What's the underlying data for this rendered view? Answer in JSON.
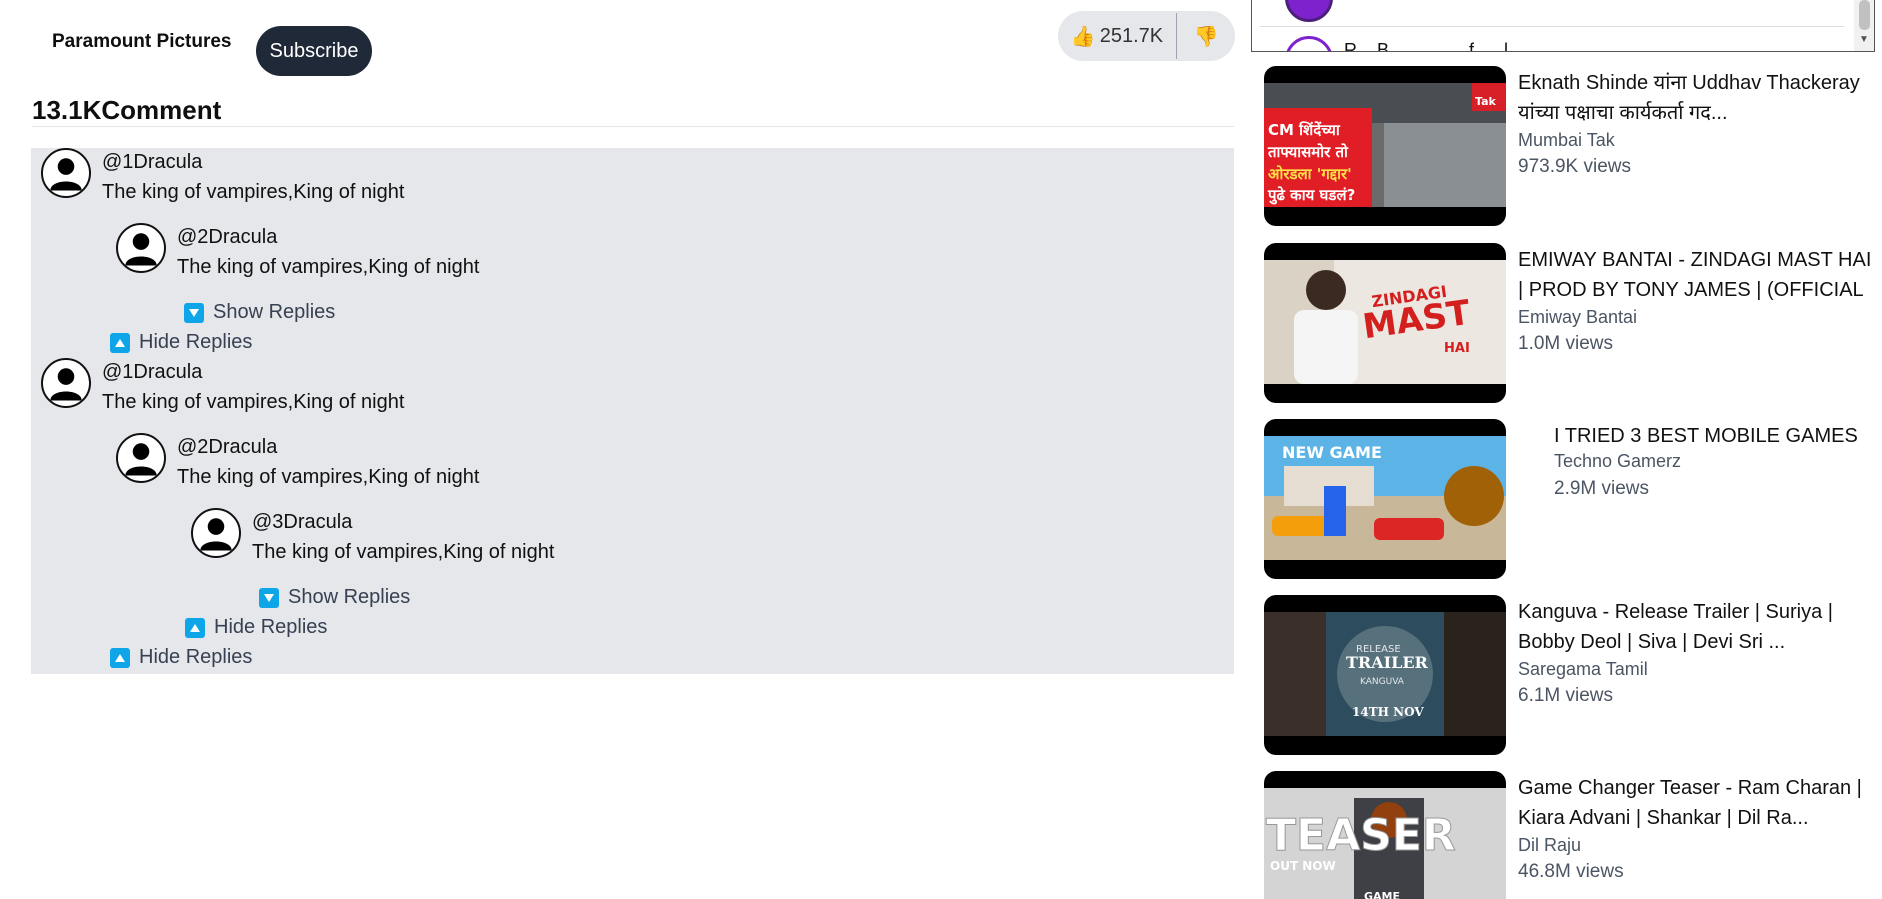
{
  "channel": {
    "name": "Paramount Pictures",
    "subscribe_label": "Subscribe"
  },
  "reactions": {
    "like_icon": "👍",
    "like_count": "251.7K",
    "dislike_icon": "👎"
  },
  "comments": {
    "count": "13.1K",
    "label": "Comment",
    "show_replies": "Show Replies",
    "hide_replies": "Hide Replies",
    "threads": [
      {
        "user": "@1Dracula",
        "text": "The king of vampires,King of night",
        "replies": [
          {
            "user": "@2Dracula",
            "text": "The king of vampires,King of night"
          }
        ]
      },
      {
        "user": "@1Dracula",
        "text": "The king of vampires,King of night",
        "replies": [
          {
            "user": "@2Dracula",
            "text": "The king of vampires,King of night",
            "replies": [
              {
                "user": "@3Dracula",
                "text": "The king of vampires,King of night"
              }
            ]
          }
        ]
      }
    ]
  },
  "popup": {
    "peek_text": "R... B... ... ... ... f. ... l ..."
  },
  "recommendations": [
    {
      "title": "Eknath Shinde यांना Uddhav Thackeray यांच्या पक्षाचा कार्यकर्ता गद...",
      "channel": "Mumbai Tak",
      "views": "973.9K views",
      "thumb_text": "CM शिंदेंच्या ताफ्यासमोर तो ओरडला 'गद्दार' पुढे काय घडलं?",
      "thumb_badge": "मुंबई Tak"
    },
    {
      "title": "EMIWAY BANTAI - ZINDAGI MAST HAI | PROD BY TONY JAMES | (OFFICIAL ...",
      "channel": "Emiway Bantai",
      "views": "1.0M views",
      "thumb_text": "ZINDAGI MAST HAI"
    },
    {
      "title": "I TRIED 3 BEST MOBILE GAMES",
      "channel": "Techno Gamerz",
      "views": "2.9M views",
      "thumb_text": "NEW GAME"
    },
    {
      "title": "Kanguva - Release Trailer | Suriya | Bobby Deol | Siva | Devi Sri ...",
      "channel": "Saregama Tamil",
      "views": "6.1M views",
      "thumb_text": "RELEASE TRAILER KANGUVA 14TH NOV"
    },
    {
      "title": "Game Changer Teaser - Ram Charan | Kiara Advani | Shankar | Dil Ra...",
      "channel": "Dil Raju",
      "views": "46.8M views",
      "thumb_text": "TEASER OUT NOW GAME CHANGER"
    }
  ],
  "colors": {
    "subscribe_bg": "#1f2937",
    "comments_bg": "#e5e7eb",
    "toggle_icon": "#0ea5e9",
    "like_bg": "#e5e7eb"
  }
}
